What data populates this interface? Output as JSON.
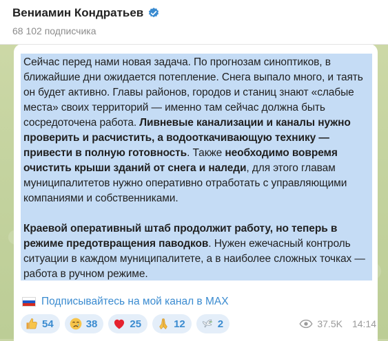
{
  "header": {
    "channel_name": "Вениамин Кондратьев",
    "subscribers": "68 102 подписчика",
    "verified_color": "#3a8bd0"
  },
  "message": {
    "p1_t1": "Сейчас перед нами новая задача. По прогнозам синоптиков, в ближайшие дни ожидается потепление. Снега выпало много, и таять он будет активно. Главы районов, городов и станиц знают «слабые места» своих территорий — именно там сейчас должна быть сосредоточена работа. ",
    "p1_b1": "Ливневые канализации и каналы нужно проверить и расчистить, а водооткачивающую технику — привести в полную готовность",
    "p1_t2": ". Также ",
    "p1_b2": "необходимо вовремя очистить крыши зданий от снега и наледи",
    "p1_t3": ", для этого главам муниципалитетов нужно оперативно отработать с управляющими компаниями и собственниками.",
    "p2_b1": "Краевой оперативный штаб продолжит работу, но теперь в режиме предотвращения паводков",
    "p2_t1": ". Нужен ежечасный контроль ситуации в каждом муниципалитете, а в наиболее сложных точках — работа в ручном режиме.",
    "highlight_color": "#c5dcf5"
  },
  "promo": {
    "flag_icon": "russia-flag-icon",
    "link_text": "Подписывайтесь на мой канал в MAX",
    "link_color": "#3a8bd0"
  },
  "reactions": [
    {
      "icon": "thumbs-up-icon",
      "count": "54"
    },
    {
      "icon": "crying-face-icon",
      "count": "38"
    },
    {
      "icon": "red-heart-icon",
      "count": "25"
    },
    {
      "icon": "folded-hands-icon",
      "count": "12"
    },
    {
      "icon": "dove-icon",
      "count": "2"
    }
  ],
  "meta": {
    "views": "37.5K",
    "time": "14:14",
    "views_icon": "eye-icon"
  }
}
